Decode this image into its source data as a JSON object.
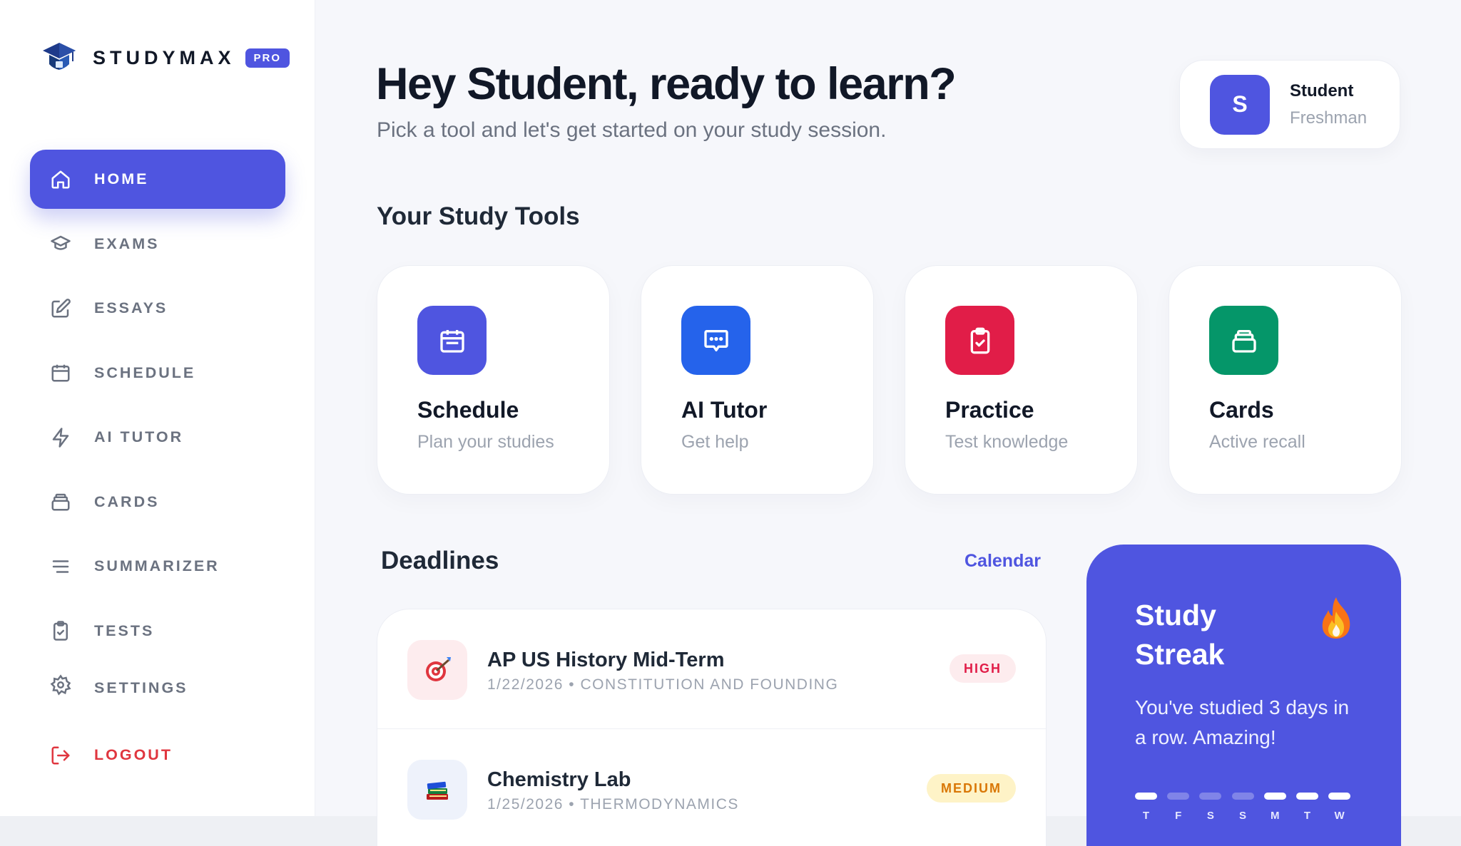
{
  "brand": {
    "name": "STUDYMAX",
    "badge": "PRO"
  },
  "nav": {
    "items": [
      {
        "label": "HOME",
        "icon": "home-icon",
        "active": true
      },
      {
        "label": "EXAMS",
        "icon": "graduation-cap-icon"
      },
      {
        "label": "ESSAYS",
        "icon": "edit-icon"
      },
      {
        "label": "SCHEDULE",
        "icon": "calendar-icon"
      },
      {
        "label": "AI TUTOR",
        "icon": "lightning-icon"
      },
      {
        "label": "CARDS",
        "icon": "cards-stack-icon"
      },
      {
        "label": "SUMMARIZER",
        "icon": "lines-icon"
      },
      {
        "label": "TESTS",
        "icon": "clipboard-check-icon"
      },
      {
        "label": "SETTINGS",
        "icon": "gear-icon"
      }
    ],
    "logout": {
      "label": "LOGOUT",
      "icon": "logout-icon",
      "color": "#e0363f"
    }
  },
  "header": {
    "greeting": "Hey Student, ready to learn?",
    "subtitle": "Pick a tool and let's get started on your study session."
  },
  "profile": {
    "initial": "S",
    "name": "Student",
    "level": "Freshman"
  },
  "tools": {
    "title": "Your Study Tools",
    "items": [
      {
        "title": "Schedule",
        "subtitle": "Plan your studies",
        "icon": "calendar-icon",
        "color": "#4f55e0"
      },
      {
        "title": "AI Tutor",
        "subtitle": "Get help",
        "icon": "chat-icon",
        "color": "#2563eb"
      },
      {
        "title": "Practice",
        "subtitle": "Test knowledge",
        "icon": "clipboard-check-icon",
        "color": "#e11d48"
      },
      {
        "title": "Cards",
        "subtitle": "Active recall",
        "icon": "cards-stack-icon",
        "color": "#059669"
      }
    ]
  },
  "deadlines": {
    "title": "Deadlines",
    "link": "Calendar",
    "items": [
      {
        "title": "AP US History Mid-Term",
        "meta": "1/22/2026 • CONSTITUTION AND FOUNDING",
        "priority": "HIGH",
        "icon": "target-icon"
      },
      {
        "title": "Chemistry Lab",
        "meta": "1/25/2026 • THERMODYNAMICS",
        "priority": "MEDIUM",
        "icon": "books-icon"
      }
    ]
  },
  "streak": {
    "title": "Study Streak",
    "icon": "fire-icon",
    "message": "You've studied 3 days in a row. Amazing!",
    "days": [
      {
        "label": "T",
        "done": true
      },
      {
        "label": "F",
        "done": false
      },
      {
        "label": "S",
        "done": false
      },
      {
        "label": "S",
        "done": false
      },
      {
        "label": "M",
        "done": true
      },
      {
        "label": "T",
        "done": true
      },
      {
        "label": "W",
        "done": true
      }
    ]
  },
  "colors": {
    "accent": "#4f55e0",
    "danger": "#e0363f",
    "high": "#e11d48",
    "medium": "#d97706"
  }
}
